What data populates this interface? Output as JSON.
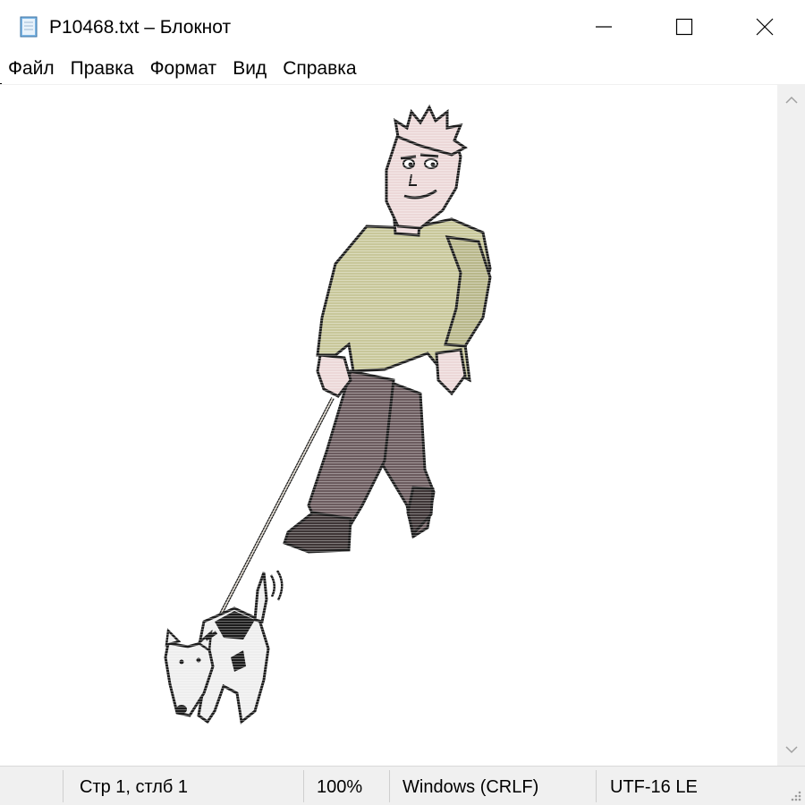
{
  "window": {
    "title": "P10468.txt – Блокнот",
    "icon": "notepad-icon",
    "controls": [
      "minimize-icon",
      "maximize-icon",
      "close-icon"
    ]
  },
  "menu": {
    "items": [
      {
        "label": "Файл"
      },
      {
        "label": "Правка"
      },
      {
        "label": "Формат"
      },
      {
        "label": "Вид"
      },
      {
        "label": "Справка"
      }
    ]
  },
  "editor": {
    "content_image": "man-walking-dog-ascii-art"
  },
  "status": {
    "position": "Стр 1, стлб 1",
    "zoom": "100%",
    "line_ending": "Windows (CRLF)",
    "encoding": "UTF-16 LE"
  },
  "colors": {
    "sweater": "#c8c79a",
    "trousers": "#6b5b5e",
    "skin": "#ecd8d8",
    "outline": "#1c1c1c",
    "chrome": "#f0f0f0"
  }
}
